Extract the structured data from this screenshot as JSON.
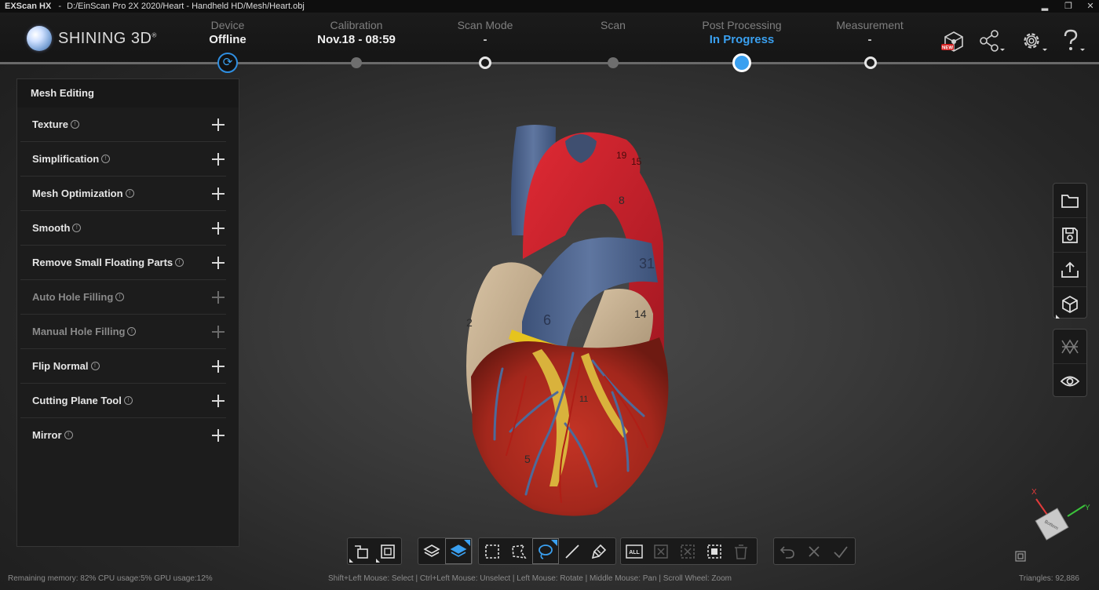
{
  "window": {
    "app_name": "EXScan HX",
    "separator": "-",
    "path": "D:/EinScan Pro 2X 2020/Heart - Handheld HD/Mesh/Heart.obj",
    "minimize": "▂",
    "restore": "❐",
    "close": "✕"
  },
  "logo": {
    "brand": "SHINING 3D",
    "mark": "®"
  },
  "steps": [
    {
      "label": "Device",
      "value": "Offline"
    },
    {
      "label": "Calibration",
      "value": "Nov.18 - 08:59"
    },
    {
      "label": "Scan Mode",
      "value": "-"
    },
    {
      "label": "Scan",
      "value": ""
    },
    {
      "label": "Post Processing",
      "value": "In Progress"
    },
    {
      "label": "Measurement",
      "value": "-"
    }
  ],
  "header_icons": [
    "model-new-icon",
    "share-icon",
    "settings-icon",
    "help-icon"
  ],
  "new_badge": "NEW",
  "panel": {
    "title": "Mesh Editing",
    "items": [
      {
        "label": "Texture",
        "enabled": true
      },
      {
        "label": "Simplification",
        "enabled": true
      },
      {
        "label": "Mesh Optimization",
        "enabled": true
      },
      {
        "label": "Smooth",
        "enabled": true
      },
      {
        "label": "Remove Small Floating Parts",
        "enabled": true
      },
      {
        "label": "Auto Hole Filling",
        "enabled": false
      },
      {
        "label": "Manual Hole Filling",
        "enabled": false
      },
      {
        "label": "Flip Normal",
        "enabled": true
      },
      {
        "label": "Cutting Plane Tool",
        "enabled": true
      },
      {
        "label": "Mirror",
        "enabled": true
      }
    ],
    "info_glyph": "!"
  },
  "right_toolbar": [
    "open-folder-icon",
    "save-icon",
    "export-icon",
    "cube-view-icon"
  ],
  "right_toolbar2": [
    "mesh-visibility-icon",
    "eye-icon"
  ],
  "bottom_toolbar": {
    "select_all_label": "ALL"
  },
  "model_labels": [
    "2",
    "6",
    "8",
    "31",
    "14",
    "5",
    "11",
    "15",
    "19"
  ],
  "gizmo": {
    "x": "X",
    "y": "Y",
    "cube_label": "Bottom"
  },
  "status": {
    "resources": "Remaining memory: 82% CPU usage:5%  GPU usage:12%",
    "hints": "Shift+Left Mouse: Select | Ctrl+Left Mouse: Unselect | Left Mouse: Rotate | Middle Mouse: Pan | Scroll Wheel: Zoom",
    "triangles": "Triangles: 92,886"
  },
  "colors": {
    "accent": "#3aa0f0",
    "panel_bg": "#1c1c1c",
    "header_bg": "#171717"
  }
}
